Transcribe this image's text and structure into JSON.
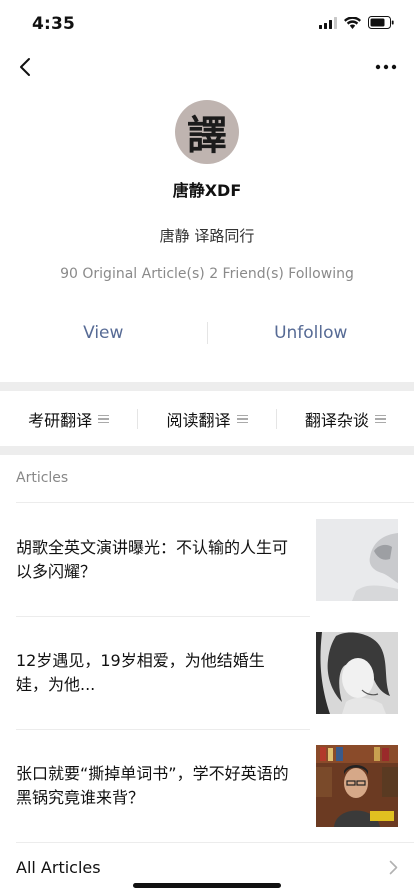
{
  "status": {
    "time": "4:35"
  },
  "profile": {
    "avatar_char": "譯",
    "name": "唐静XDF",
    "signature": "唐静 译路同行",
    "stats": "90 Original Article(s)  2 Friend(s) Following"
  },
  "actions": {
    "view": "View",
    "unfollow": "Unfollow"
  },
  "menu": [
    {
      "label": "考研翻译"
    },
    {
      "label": "阅读翻译"
    },
    {
      "label": "翻译杂谈"
    }
  ],
  "articles_header": "Articles",
  "articles": [
    {
      "title": "胡歌全英文演讲曝光：不认输的人生可以多闪耀？"
    },
    {
      "title": "12岁遇见，19岁相爱，为他结婚生娃，为他..."
    },
    {
      "title": "张口就要“撕掉单词书”，学不好英语的黑锅究竟谁来背？"
    }
  ],
  "all_articles": "All Articles",
  "colors": {
    "link": "#576b95",
    "separator": "#ededed"
  }
}
